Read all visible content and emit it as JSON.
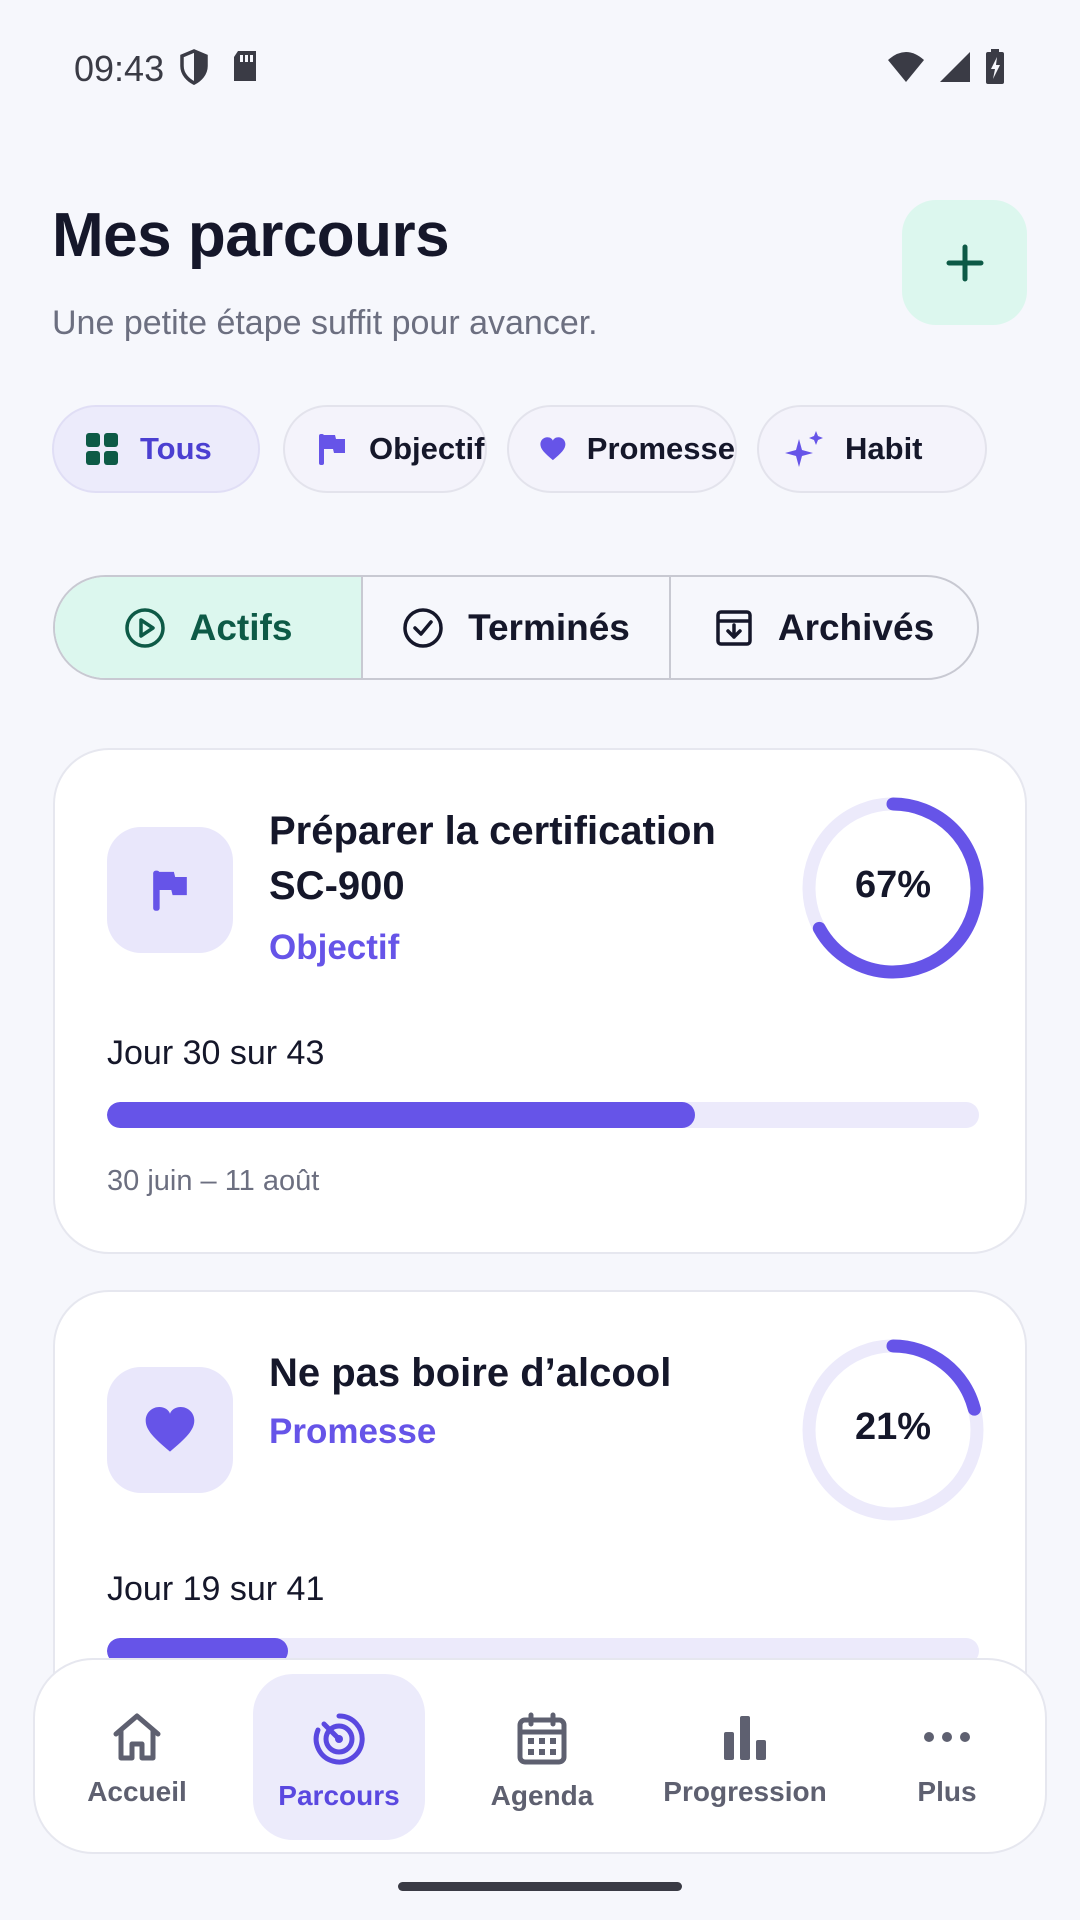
{
  "status_bar": {
    "time": "09:43",
    "left_icons": [
      "shield-icon",
      "sd-card-icon"
    ],
    "right_icons": [
      "wifi-icon",
      "signal-icon",
      "battery-charging-icon"
    ]
  },
  "header": {
    "title": "Mes parcours",
    "subtitle": "Une petite étape suffit pour avancer.",
    "add_icon": "plus-icon"
  },
  "filters": [
    {
      "label": "Tous",
      "icon": "grid-icon",
      "selected": true
    },
    {
      "label": "Objectif",
      "icon": "flag-icon",
      "selected": false
    },
    {
      "label": "Promesse",
      "icon": "heart-icon",
      "selected": false
    },
    {
      "label": "Habit",
      "icon": "sparkles-icon",
      "selected": false
    }
  ],
  "tabs": [
    {
      "label": "Actifs",
      "icon": "play-circle-icon",
      "active": true
    },
    {
      "label": "Terminés",
      "icon": "check-circle-icon",
      "active": false
    },
    {
      "label": "Archivés",
      "icon": "archive-icon",
      "active": false
    }
  ],
  "journeys": [
    {
      "title_line1": "Préparer la certification",
      "title_line2": "SC-900",
      "type": "Objectif",
      "icon": "flag-icon",
      "percent_label": "67%",
      "percent": 0.67,
      "day_label": "Jour 30 sur 43",
      "day_progress": 0.674,
      "date_range": "30 juin – 11 août"
    },
    {
      "title_line1": "Ne pas boire d’alcool",
      "type": "Promesse",
      "icon": "heart-icon",
      "percent_label": "21%",
      "percent": 0.21,
      "day_label": "Jour 19 sur 41",
      "day_progress": 0.207
    }
  ],
  "bottom_nav": [
    {
      "label": "Accueil",
      "icon": "home-icon",
      "active": false
    },
    {
      "label": "Parcours",
      "icon": "target-icon",
      "active": true
    },
    {
      "label": "Agenda",
      "icon": "calendar-icon",
      "active": false
    },
    {
      "label": "Progression",
      "icon": "bar-chart-icon",
      "active": false
    },
    {
      "label": "Plus",
      "icon": "more-icon",
      "active": false
    }
  ],
  "colors": {
    "accent": "#6654e8",
    "accent_soft": "#ecebfb",
    "mint": "#dcf7ee",
    "mint_dark": "#0d5a46",
    "text": "#15172a",
    "muted": "#6c6f80"
  }
}
